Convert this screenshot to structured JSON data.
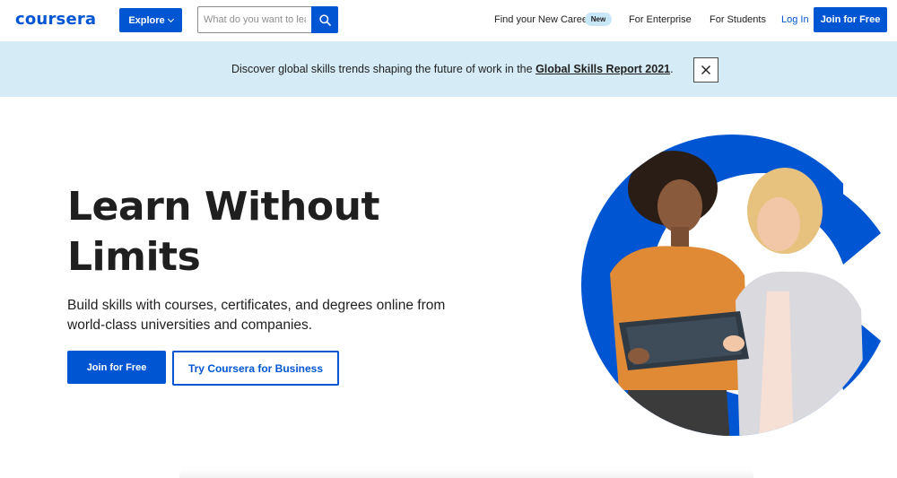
{
  "header": {
    "logo": "coursera",
    "explore_label": "Explore",
    "search_placeholder": "What do you want to learn?",
    "nav_career": "Find your New Career",
    "new_badge": "New",
    "nav_enterprise": "For Enterprise",
    "nav_students": "For Students",
    "login": "Log In",
    "join": "Join for Free"
  },
  "banner": {
    "text_before": "Discover global skills trends shaping the future of work in the ",
    "link": "Global Skills Report 2021",
    "text_after": "."
  },
  "hero": {
    "title_line1": "Learn Without",
    "title_line2": "Limits",
    "subtitle": "Build skills with courses, certificates, and degrees online from world-class universities and companies.",
    "join_button": "Join for Free",
    "business_button": "Try Coursera for Business"
  },
  "colors": {
    "brand": "#0056d2",
    "banner_bg": "#d5ebf5",
    "badge_bg": "#c8e7f6"
  },
  "icons": {
    "search": "search-icon",
    "close": "close-icon",
    "chevron": "chevron-down-icon"
  }
}
